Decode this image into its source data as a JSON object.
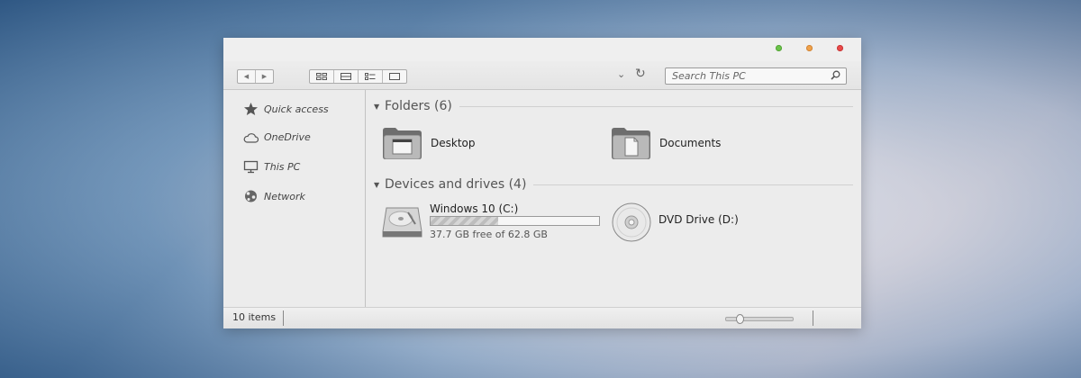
{
  "window": {
    "controls": [
      {
        "name": "minimize",
        "color": "#6bc44a"
      },
      {
        "name": "maximize",
        "color": "#f0a24a"
      },
      {
        "name": "close",
        "color": "#ea4a4a"
      }
    ]
  },
  "toolbar": {
    "nav_back_icon": "◀",
    "nav_forward_icon": "▶",
    "view_icons": [
      "large-icons-icon",
      "list-icon",
      "details-icon",
      "tiles-icon"
    ],
    "history_icon": "⌄",
    "refresh_icon": "↻",
    "search_placeholder": "Search This PC"
  },
  "sidebar": {
    "items": [
      {
        "label": "Quick access",
        "icon": "star-icon"
      },
      {
        "label": "OneDrive",
        "icon": "cloud-icon"
      },
      {
        "label": "This PC",
        "icon": "monitor-icon"
      },
      {
        "label": "Network",
        "icon": "network-icon"
      }
    ]
  },
  "main": {
    "folders_group": {
      "title": "Folders (6)",
      "toggle": "▼"
    },
    "folders": [
      {
        "label": "Desktop",
        "icon": "desktop-folder-icon"
      },
      {
        "label": "Documents",
        "icon": "documents-folder-icon"
      }
    ],
    "devices_group": {
      "title": "Devices and drives (4)",
      "toggle": "▼"
    },
    "drives": [
      {
        "label": "Windows 10 (C:)",
        "icon": "hard-drive-icon",
        "free_text": "37.7 GB free of 62.8 GB",
        "used_fraction": 0.4
      },
      {
        "label": "DVD Drive (D:)",
        "icon": "dvd-icon"
      }
    ]
  },
  "status": {
    "item_count": "10 items",
    "zoom_level": 0.2
  }
}
